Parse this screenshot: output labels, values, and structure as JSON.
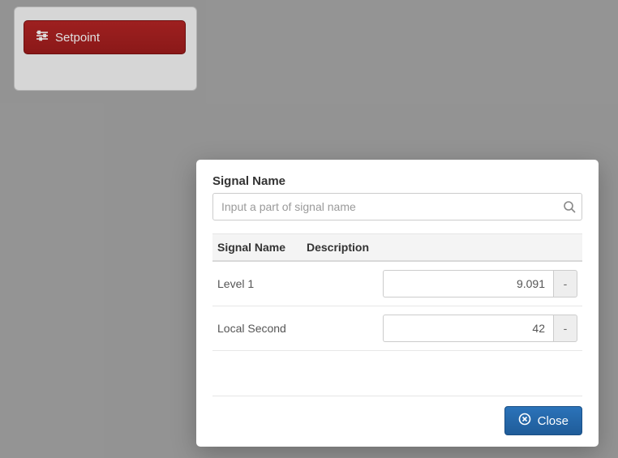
{
  "background": {
    "setpoint_label": "Setpoint"
  },
  "modal": {
    "field_label": "Signal Name",
    "search_placeholder": "Input a part of signal name",
    "columns": {
      "name": "Signal Name",
      "description": "Description"
    },
    "rows": [
      {
        "name": "Level 1",
        "description": "",
        "value": "9.091",
        "unit": "-"
      },
      {
        "name": "Local Second",
        "description": "",
        "value": "42",
        "unit": "-"
      }
    ],
    "close_label": "Close"
  }
}
